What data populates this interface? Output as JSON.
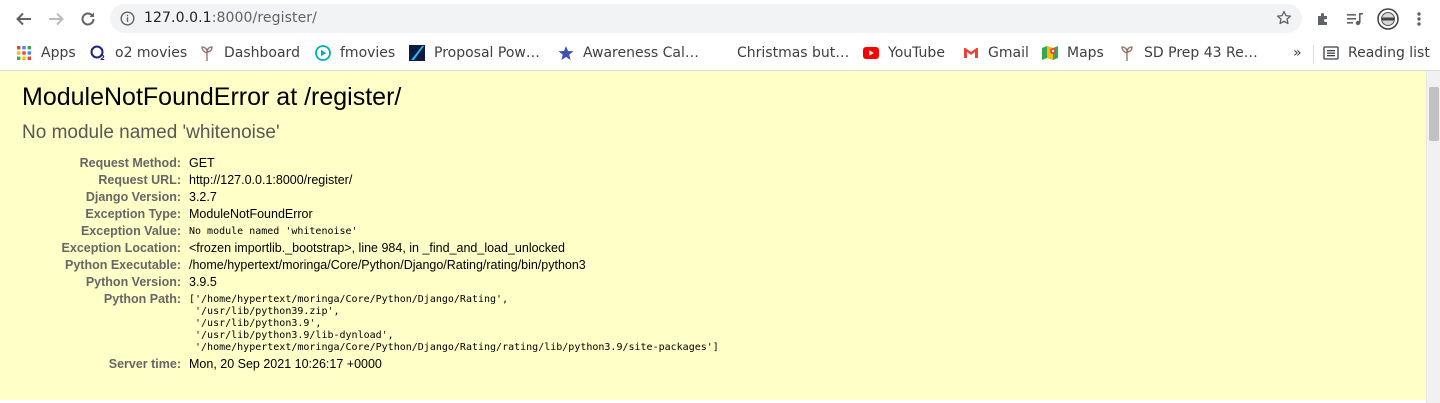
{
  "browser": {
    "address": {
      "host": "127.0.0.1",
      "port_path": ":8000/register/"
    },
    "bookmarks": [
      {
        "label": "Apps",
        "icon": "apps-grid-icon"
      },
      {
        "label": "o2 movies",
        "icon": "o2-movies-icon"
      },
      {
        "label": "Dashboard",
        "icon": "dashboard-sprout-icon"
      },
      {
        "label": "fmovies",
        "icon": "fmovies-play-icon"
      },
      {
        "label": "Proposal Pow…",
        "icon": "proposal-icon"
      },
      {
        "label": "Awareness Cal…",
        "icon": "star-icon"
      },
      {
        "label": "Christmas but…",
        "icon": "blank-page-icon"
      },
      {
        "label": "YouTube",
        "icon": "youtube-icon"
      },
      {
        "label": "Gmail",
        "icon": "gmail-icon"
      },
      {
        "label": "Maps",
        "icon": "maps-icon"
      },
      {
        "label": "SD Prep 43 Re…",
        "icon": "sd-prep-sprout-icon"
      }
    ],
    "overflow": "»",
    "reading_list": "Reading list"
  },
  "error": {
    "title": "ModuleNotFoundError at /register/",
    "subtitle": "No module named 'whitenoise'",
    "rows": [
      {
        "label": "Request Method:",
        "value": "GET"
      },
      {
        "label": "Request URL:",
        "value": "http://127.0.0.1:8000/register/"
      },
      {
        "label": "Django Version:",
        "value": "3.2.7"
      },
      {
        "label": "Exception Type:",
        "value": "ModuleNotFoundError"
      },
      {
        "label": "Exception Value:",
        "value": "No module named 'whitenoise'"
      },
      {
        "label": "Exception Location:",
        "value": "<frozen importlib._bootstrap>, line 984, in _find_and_load_unlocked"
      },
      {
        "label": "Python Executable:",
        "value": "/home/hypertext/moringa/Core/Python/Django/Rating/rating/bin/python3"
      },
      {
        "label": "Python Version:",
        "value": "3.9.5"
      },
      {
        "label": "Python Path:",
        "value": "['/home/hypertext/moringa/Core/Python/Django/Rating',\n '/usr/lib/python39.zip',\n '/usr/lib/python3.9',\n '/usr/lib/python3.9/lib-dynload',\n '/home/hypertext/moringa/Core/Python/Django/Rating/rating/lib/python3.9/site-packages']"
      },
      {
        "label": "Server time:",
        "value": "Mon, 20 Sep 2021 10:26:17 +0000"
      }
    ]
  }
}
